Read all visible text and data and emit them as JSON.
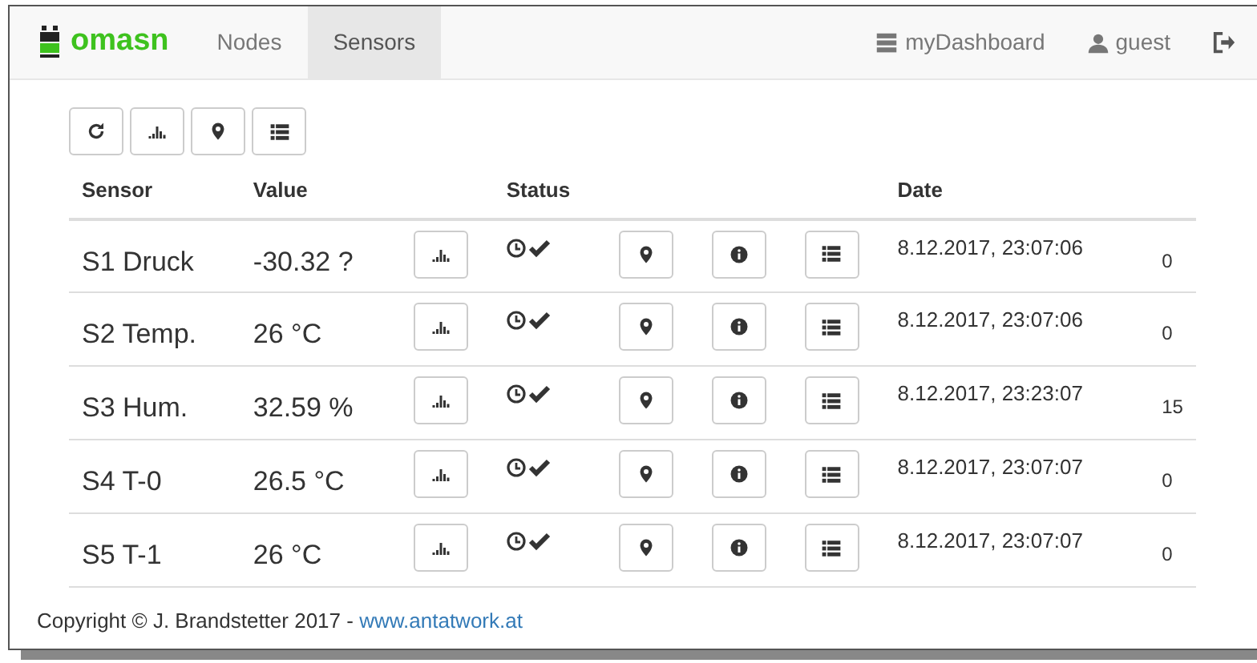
{
  "navbar": {
    "brand": "omasn",
    "nav_items": [
      {
        "label": "Nodes",
        "selected": false
      },
      {
        "label": "Sensors",
        "selected": true
      }
    ],
    "right_items": [
      {
        "label": "myDashboard"
      },
      {
        "label": "guest"
      }
    ]
  },
  "table": {
    "columns": [
      "Sensor",
      "Value",
      "Status",
      "Date"
    ],
    "rows": [
      {
        "sensor": "S1 Druck",
        "value": "-30.32 ?",
        "date": "8.12.2017, 23:07:06",
        "count": "0"
      },
      {
        "sensor": "S2 Temp.",
        "value": "26 °C",
        "date": "8.12.2017, 23:07:06",
        "count": "0"
      },
      {
        "sensor": "S3 Hum.",
        "value": "32.59 %",
        "date": "8.12.2017, 23:23:07",
        "count": "15"
      },
      {
        "sensor": "S4 T-0",
        "value": "26.5 °C",
        "date": "8.12.2017, 23:07:07",
        "count": "0"
      },
      {
        "sensor": "S5 T-1",
        "value": "26 °C",
        "date": "8.12.2017, 23:07:07",
        "count": "0"
      }
    ]
  },
  "footer": {
    "text": "Copyright © J. Brandstetter 2017 -",
    "link": "www.antatwork.at"
  }
}
